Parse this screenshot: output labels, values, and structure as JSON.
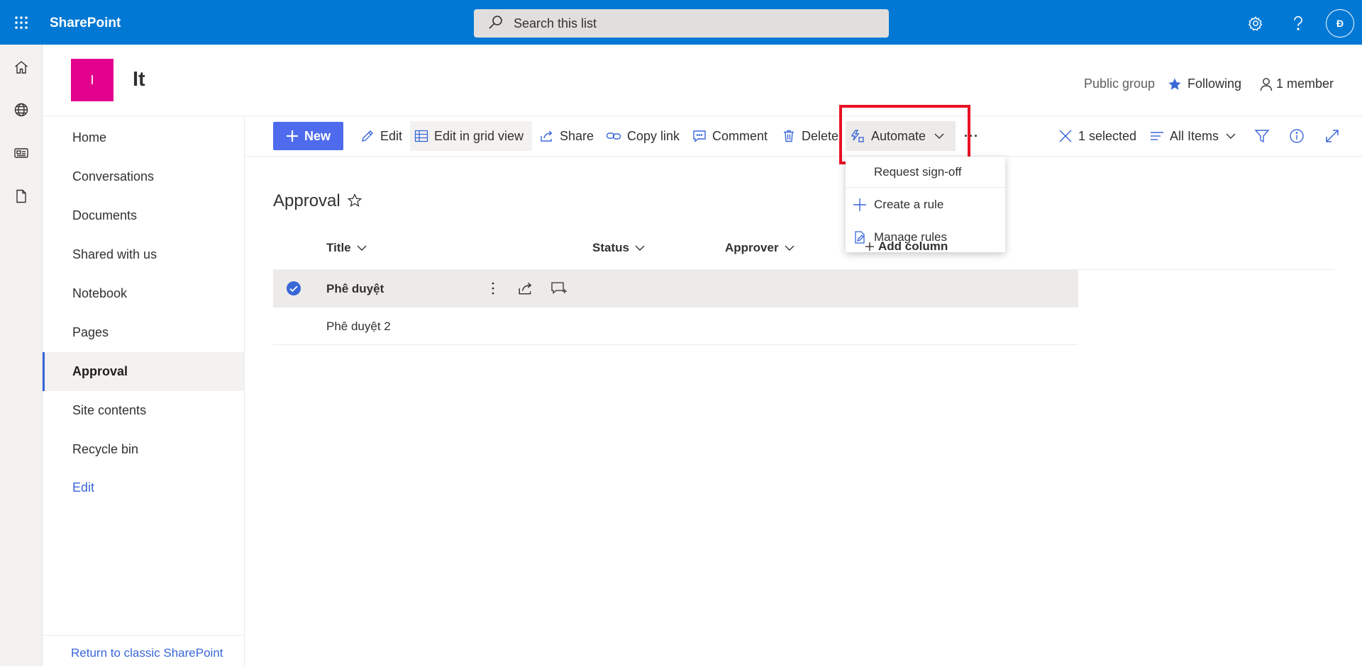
{
  "suite": {
    "brand": "SharePoint",
    "search_placeholder": "Search this list",
    "avatar_initial": "Đ"
  },
  "site": {
    "logo_letter": "I",
    "title": "It",
    "group_type": "Public group",
    "following_label": "Following",
    "members_label": "1 member",
    "logo_color": "#e3008c"
  },
  "nav": {
    "items": [
      "Home",
      "Conversations",
      "Documents",
      "Shared with us",
      "Notebook",
      "Pages",
      "Approval",
      "Site contents",
      "Recycle bin"
    ],
    "active": "Approval",
    "edit_label": "Edit",
    "classic_link": "Return to classic SharePoint"
  },
  "commands": {
    "new": "New",
    "edit": "Edit",
    "edit_grid": "Edit in grid view",
    "share": "Share",
    "copy_link": "Copy link",
    "comment": "Comment",
    "delete": "Delete",
    "automate": "Automate",
    "more": "···",
    "selected": "1 selected",
    "view": "All Items"
  },
  "automate_menu": {
    "items": [
      "Request sign-off",
      "Create a rule",
      "Manage rules"
    ]
  },
  "list": {
    "title": "Approval",
    "columns": [
      "Title",
      "Status",
      "Approver",
      "Add column"
    ],
    "rows": [
      {
        "title": "Phê duyệt",
        "selected": true
      },
      {
        "title": "Phê duyệt 2",
        "selected": false
      }
    ]
  },
  "colors": {
    "suite_bar": "#0078d4",
    "accent": "#4f6bed",
    "highlight": "#e81123"
  }
}
